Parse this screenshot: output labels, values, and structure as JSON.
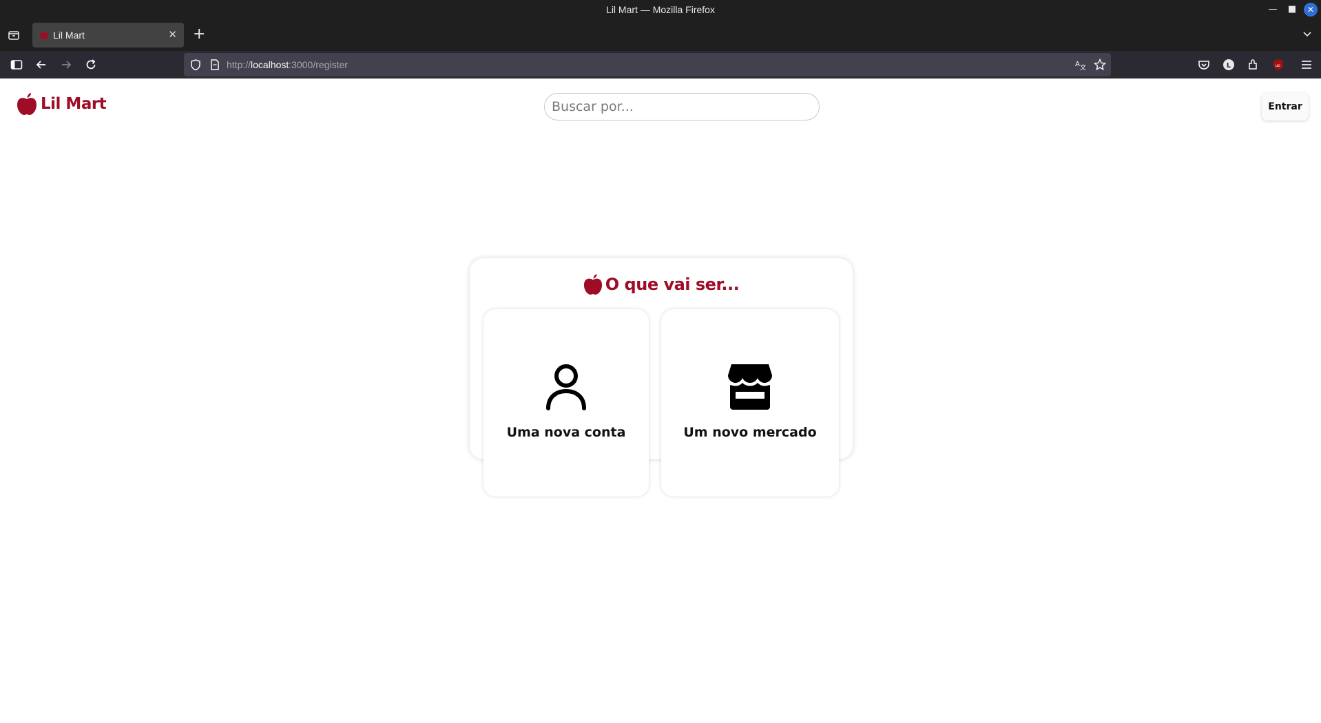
{
  "browser": {
    "window_title": "Lil Mart — Mozilla Firefox",
    "tab_title": "Lil Mart",
    "url_prefix": "http://",
    "url_host": "localhost",
    "url_path": ":3000/register"
  },
  "header": {
    "brand": "Lil Mart",
    "search_placeholder": "Buscar por...",
    "login_label": "Entrar"
  },
  "register": {
    "heading": "O que vai ser...",
    "options": [
      {
        "label": "Uma nova conta",
        "icon": "user-icon"
      },
      {
        "label": "Um novo mercado",
        "icon": "store-icon"
      }
    ]
  },
  "colors": {
    "brand": "#9f0c26",
    "chrome_dark": "#1f1f1f",
    "urlbar": "#42414d"
  }
}
